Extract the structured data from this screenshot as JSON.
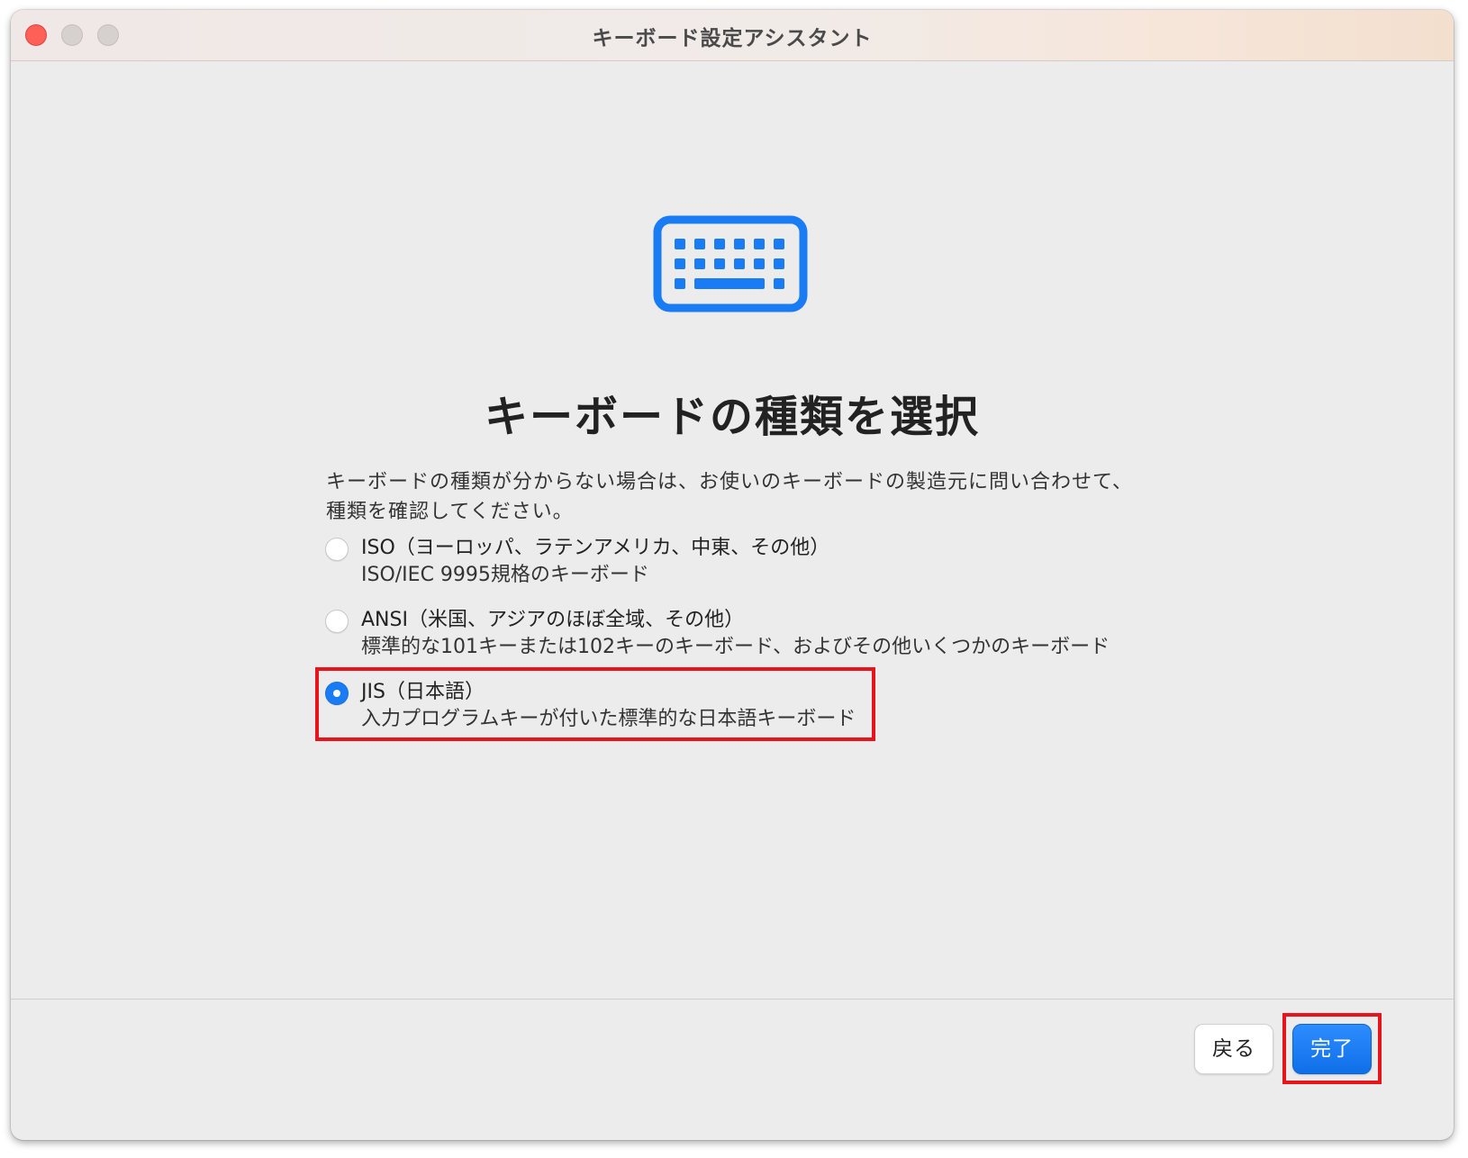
{
  "window": {
    "title": "キーボード設定アシスタント"
  },
  "main": {
    "icon": "keyboard-icon",
    "title": "キーボードの種類を選択",
    "description": "キーボードの種類が分からない場合は、お使いのキーボードの製造元に問い合わせて、種類を確認してください。"
  },
  "options": [
    {
      "title": "ISO（ヨーロッパ、ラテンアメリカ、中東、その他）",
      "desc": "ISO/IEC 9995規格のキーボード",
      "selected": false
    },
    {
      "title": "ANSI（米国、アジアのほぼ全域、その他）",
      "desc": "標準的な101キーまたは102キーのキーボード、およびその他いくつかのキーボード",
      "selected": false
    },
    {
      "title": "JIS（日本語）",
      "desc": "入力プログラムキーが付いた標準的な日本語キーボード",
      "selected": true
    }
  ],
  "footer": {
    "back_label": "戻る",
    "done_label": "完了"
  },
  "colors": {
    "accent": "#1a7cf5",
    "highlight": "#e8141b"
  }
}
